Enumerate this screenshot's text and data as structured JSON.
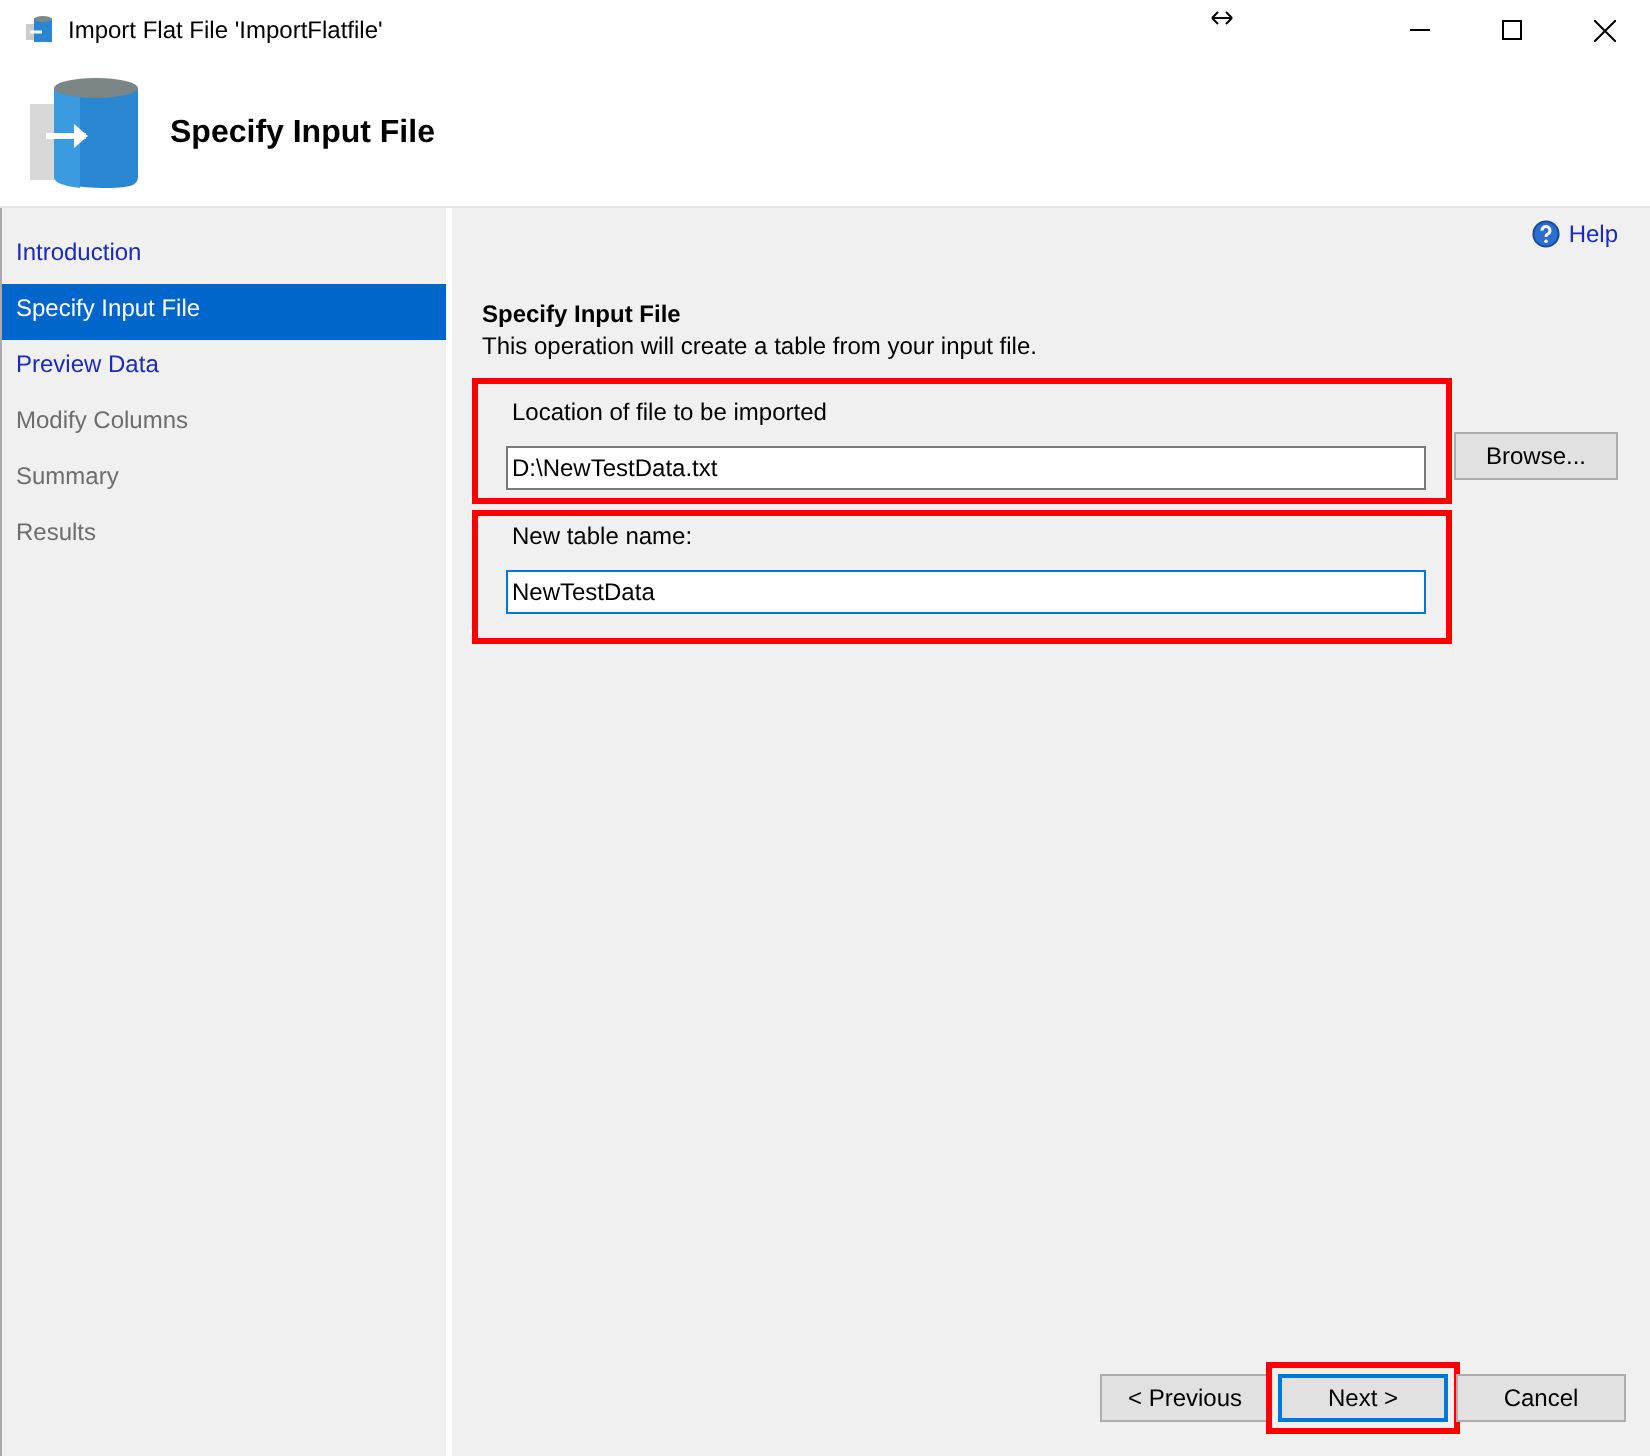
{
  "window": {
    "title": "Import Flat File 'ImportFlatfile'"
  },
  "header": {
    "title": "Specify Input File"
  },
  "sidebar": {
    "items": [
      {
        "label": "Introduction",
        "selected": false,
        "disabled": false
      },
      {
        "label": "Specify Input File",
        "selected": true,
        "disabled": false
      },
      {
        "label": "Preview Data",
        "selected": false,
        "disabled": false
      },
      {
        "label": "Modify Columns",
        "selected": false,
        "disabled": true
      },
      {
        "label": "Summary",
        "selected": false,
        "disabled": true
      },
      {
        "label": "Results",
        "selected": false,
        "disabled": true
      }
    ]
  },
  "help": {
    "label": "Help"
  },
  "page": {
    "title": "Specify Input File",
    "description": "This operation will create a table from your input file.",
    "fields": [
      {
        "label": "Location of file to be imported",
        "value": "D:\\NewTestData.txt",
        "focused": false,
        "highlighted": true,
        "button": "Browse..."
      },
      {
        "label": "New table name:",
        "value": "NewTestData",
        "focused": true,
        "highlighted": true
      }
    ]
  },
  "buttons": [
    {
      "label": "< Previous",
      "default": false,
      "highlighted": false
    },
    {
      "label": "Next >",
      "default": true,
      "highlighted": true
    },
    {
      "label": "Cancel",
      "default": false,
      "highlighted": false
    }
  ]
}
